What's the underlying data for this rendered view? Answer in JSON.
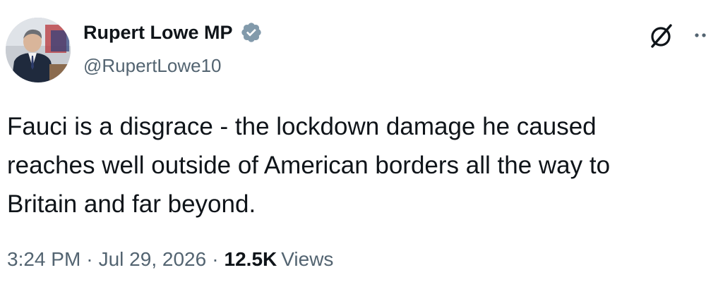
{
  "author": {
    "display_name": "Rupert Lowe MP",
    "handle": "@RupertLowe10",
    "verified_badge": "verified-badge-icon",
    "verified_color": "#829aab"
  },
  "tweet": {
    "text": "Fauci is a disgrace - the lockdown damage he caused\nreaches well outside of American borders all the way to\nBritain and far beyond.",
    "time": "3:24 PM",
    "date": "Jul 29, 2026",
    "separator": "·",
    "views_count": "12.5K",
    "views_label": "Views"
  },
  "actions": {
    "grok_icon": "grok-icon",
    "more_icon": "more-options-icon"
  },
  "colors": {
    "primary_text": "#0f1419",
    "secondary_text": "#536471",
    "background": "#ffffff"
  }
}
